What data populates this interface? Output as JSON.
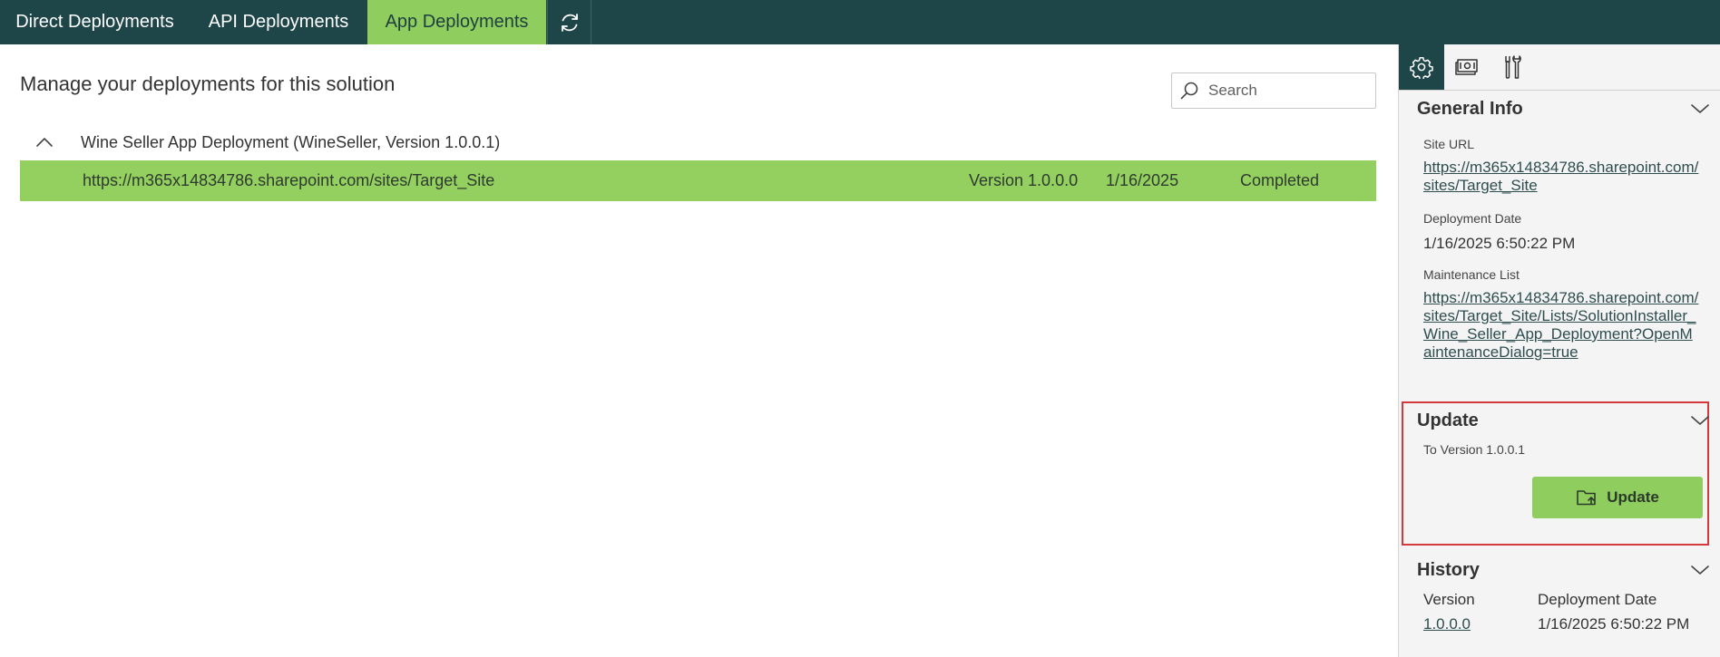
{
  "tabs": {
    "direct": "Direct Deployments",
    "api": "API Deployments",
    "app": "App Deployments",
    "refresh_icon": "refresh-icon"
  },
  "main": {
    "title": "Manage your deployments for this solution",
    "search_placeholder": "Search",
    "group": {
      "label": "Wine Seller App Deployment (WineSeller, Version 1.0.0.1)",
      "expanded": true
    },
    "row": {
      "url": "https://m365x14834786.sharepoint.com/sites/Target_Site",
      "version": "Version 1.0.0.0",
      "date": "1/16/2025",
      "status": "Completed"
    }
  },
  "side": {
    "tab_icons": [
      "settings-icon",
      "money-icon",
      "tools-icon"
    ],
    "general": {
      "title": "General Info",
      "site_url_label": "Site URL",
      "site_url": "https://m365x14834786.sharepoint.com/sites/Target_Site",
      "deployment_date_label": "Deployment Date",
      "deployment_date": "1/16/2025 6:50:22 PM",
      "maintenance_label": "Maintenance List",
      "maintenance_url": "https://m365x14834786.sharepoint.com/sites/Target_Site/Lists/SolutionInstaller_Wine_Seller_App_Deployment?OpenMaintenanceDialog=true"
    },
    "update": {
      "title": "Update",
      "to_version": "To Version 1.0.0.1",
      "button_label": "Update"
    },
    "history": {
      "title": "History",
      "col_version": "Version",
      "col_date": "Deployment Date",
      "rows": [
        {
          "version": "1.0.0.0",
          "date": "1/16/2025 6:50:22 PM"
        }
      ]
    }
  },
  "colors": {
    "topbar": "#1e4548",
    "accent_green": "#8fce5e",
    "highlight_border": "#d6393c"
  }
}
